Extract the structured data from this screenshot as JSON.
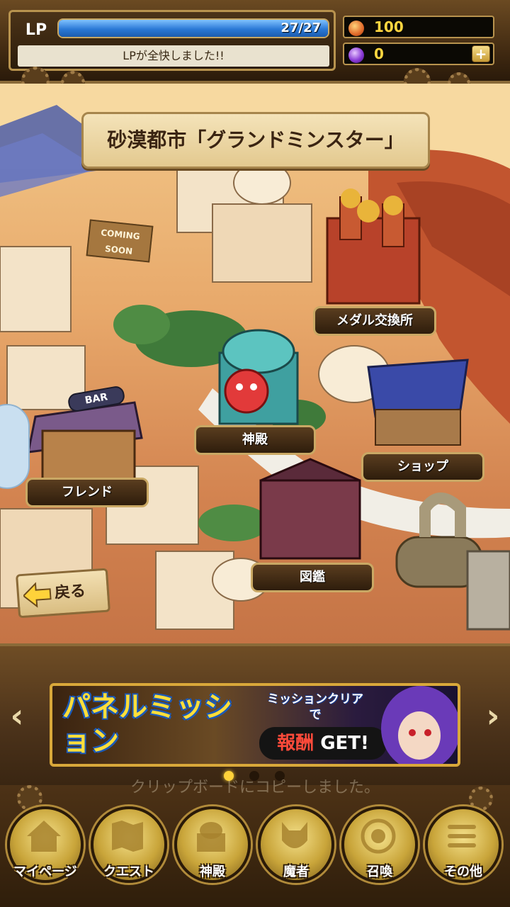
{
  "header": {
    "lp_label": "LP",
    "lp_count": "27/27",
    "lp_fraction": 1.0,
    "lp_status": "LPが全快しました!!",
    "currency_1_value": "100",
    "currency_2_value": "0",
    "currency_1_icon": "gold-bag-icon",
    "currency_2_icon": "purple-gem-icon",
    "plus_label": "+"
  },
  "map": {
    "title": "砂漠都市「グランドミンスター」",
    "coming_soon": "COMING SOON",
    "locations": {
      "medal": "メダル交換所",
      "temple": "神殿",
      "shop": "ショップ",
      "friend": "フレンド",
      "bar_sign": "BAR",
      "library": "図鑑"
    },
    "back_label": "戻る"
  },
  "banner": {
    "title": "パネルミッション",
    "subtitle": "ミッションクリアで",
    "reward_highlight": "報酬",
    "reward_text": "GET!",
    "prev": "‹",
    "next": "›",
    "page_count": 3,
    "active_page": 1
  },
  "toast": "クリップボードにコピーしました。",
  "nav": {
    "items": [
      {
        "label": "マイページ",
        "icon": "house-icon"
      },
      {
        "label": "クエスト",
        "icon": "quest-map-icon"
      },
      {
        "label": "神殿",
        "icon": "temple-icon"
      },
      {
        "label": "魔者",
        "icon": "monster-icon"
      },
      {
        "label": "召喚",
        "icon": "summon-icon"
      },
      {
        "label": "その他",
        "icon": "menu-icon"
      }
    ]
  },
  "colors": {
    "accent_gold": "#d9a83a",
    "lp_blue": "#2a78d6",
    "panel_brown": "#3d2710"
  }
}
